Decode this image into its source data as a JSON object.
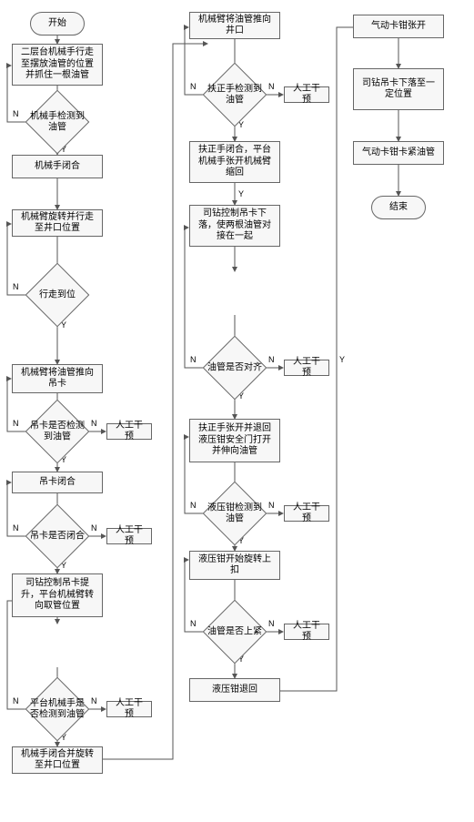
{
  "chart_data": {
    "type": "flowchart",
    "title": "",
    "columns": 3,
    "nodes": [
      {
        "id": "start",
        "col": 1,
        "type": "terminator",
        "text": "开始"
      },
      {
        "id": "c1_p1",
        "col": 1,
        "type": "process",
        "text": "二层台机械手行走至摆放油管的位置并抓住一根油管"
      },
      {
        "id": "c1_d1",
        "col": 1,
        "type": "decision",
        "text": "机械手检测到油管",
        "yes": "c1_p2",
        "no": "c1_p1"
      },
      {
        "id": "c1_p2",
        "col": 1,
        "type": "process",
        "text": "机械手闭合"
      },
      {
        "id": "c1_p3",
        "col": 1,
        "type": "process",
        "text": "机械臂旋转并行走至井口位置"
      },
      {
        "id": "c1_d2",
        "col": 1,
        "type": "decision",
        "text": "行走到位",
        "yes": "c1_p4",
        "no": "c1_p3"
      },
      {
        "id": "c1_p4",
        "col": 1,
        "type": "process",
        "text": "机械臂将油管推向吊卡"
      },
      {
        "id": "c1_d3",
        "col": 1,
        "type": "decision",
        "text": "吊卡是否检测到油管",
        "yes": "c1_p5",
        "no": "c1_p4",
        "no_alt": "人工干预"
      },
      {
        "id": "c1_p5",
        "col": 1,
        "type": "process",
        "text": "吊卡闭合"
      },
      {
        "id": "c1_d4",
        "col": 1,
        "type": "decision",
        "text": "吊卡是否闭合",
        "yes": "c1_p6",
        "no": "c1_p5",
        "no_alt": "人工干预"
      },
      {
        "id": "c1_p6",
        "col": 1,
        "type": "process",
        "text": "司钻控制吊卡提升，平台机械臂转向取管位置"
      },
      {
        "id": "c1_d5",
        "col": 1,
        "type": "decision",
        "text": "平台机械手是否检测到油管",
        "yes": "c1_p7",
        "no": "c1_p6",
        "no_alt": "人工干预"
      },
      {
        "id": "c1_p7",
        "col": 1,
        "type": "process",
        "text": "机械手闭合并旋转至井口位置"
      },
      {
        "id": "c2_p1",
        "col": 2,
        "type": "process",
        "text": "机械臂将油管推向井口"
      },
      {
        "id": "c2_d1",
        "col": 2,
        "type": "decision",
        "text": "扶正手检测到油管",
        "yes": "c2_p2",
        "no": "c2_p1",
        "no_alt": "人工干预"
      },
      {
        "id": "c2_p2",
        "col": 2,
        "type": "process",
        "text": "扶正手闭合，平台机械手张开机械臂缩回"
      },
      {
        "id": "c2_p3",
        "col": 2,
        "type": "process",
        "text": "司钻控制吊卡下落，使两根油管对接在一起"
      },
      {
        "id": "c2_d2",
        "col": 2,
        "type": "decision",
        "text": "油管是否对齐",
        "yes": "c2_p4",
        "no": "c2_p3",
        "no_alt": "人工干预"
      },
      {
        "id": "c2_p4",
        "col": 2,
        "type": "process",
        "text": "扶正手张开并退回液压钳安全门打开并伸向油管"
      },
      {
        "id": "c2_d3",
        "col": 2,
        "type": "decision",
        "text": "液压钳检测到油管",
        "yes": "c2_p5",
        "no": "c2_p4",
        "no_alt": "人工干预"
      },
      {
        "id": "c2_p5",
        "col": 2,
        "type": "process",
        "text": "液压钳开始旋转上扣"
      },
      {
        "id": "c2_d4",
        "col": 2,
        "type": "decision",
        "text": "油管是否上紧",
        "yes": "c2_p6",
        "no": "c2_p5",
        "no_alt": "人工干预"
      },
      {
        "id": "c2_p6",
        "col": 2,
        "type": "process",
        "text": "液压钳退回"
      },
      {
        "id": "c3_p1",
        "col": 3,
        "type": "process",
        "text": "气动卡钳张开"
      },
      {
        "id": "c3_p2",
        "col": 3,
        "type": "process",
        "text": "司钻吊卡下落至一定位置"
      },
      {
        "id": "c3_p3",
        "col": 3,
        "type": "process",
        "text": "气动卡钳卡紧油管"
      },
      {
        "id": "end",
        "col": 3,
        "type": "terminator",
        "text": "结束"
      }
    ],
    "labels": {
      "yes": "Y",
      "no": "N",
      "manual": "人工干预"
    },
    "cross_column_edges": [
      {
        "from": "c1_p7",
        "to": "c2_p1"
      },
      {
        "from": "c2_p6",
        "to": "c3_p1"
      }
    ]
  }
}
